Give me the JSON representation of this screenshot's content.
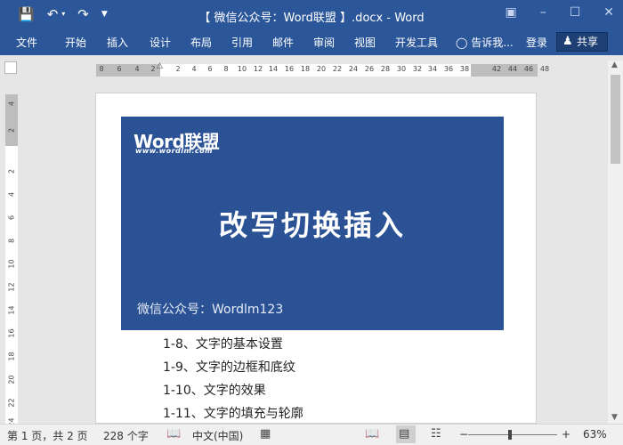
{
  "window": {
    "title": "【 微信公众号：Word联盟 】.docx - Word",
    "icons": [
      "save-icon",
      "undo-icon",
      "undo-dropdown-icon",
      "redo-icon",
      "customize-qat-icon",
      "ribbon-display-icon",
      "minimize-icon",
      "maximize-icon",
      "close-icon"
    ]
  },
  "ribbon": {
    "tabs": [
      "文件",
      "开始",
      "插入",
      "设计",
      "布局",
      "引用",
      "邮件",
      "审阅",
      "视图",
      "开发工具"
    ],
    "tell_me": "告诉我...",
    "login": "登录",
    "share": "共享"
  },
  "ruler": {
    "h_left": [
      "8",
      "6",
      "4",
      "2"
    ],
    "h_right": [
      "2",
      "4",
      "6",
      "8",
      "10",
      "12",
      "14",
      "16",
      "18",
      "20",
      "22",
      "24",
      "26",
      "28",
      "30",
      "32",
      "34",
      "36",
      "38",
      "42",
      "44",
      "46",
      "48"
    ],
    "v_labels": [
      "4",
      "2",
      "2",
      "4",
      "6",
      "8",
      "10",
      "12",
      "14",
      "16",
      "18",
      "20",
      "22",
      "24"
    ]
  },
  "document": {
    "banner": {
      "logo": "Word联盟",
      "logo_url": "www.wordlm.com",
      "title": "改写切换插入",
      "footer": "微信公众号：Wordlm123",
      "color": "#2b5295"
    },
    "lines": [
      "1-8、文字的基本设置",
      "1-9、文字的边框和底纹",
      "1-10、文字的效果",
      "1-11、文字的填充与轮廓"
    ]
  },
  "status": {
    "page": "第 1 页，共 2 页",
    "words": "228 个字",
    "language": "中文(中国)",
    "zoom": "63%",
    "zoom_minus": "−",
    "zoom_plus": "+"
  },
  "colors": {
    "accent": "#2b579a",
    "share_bg": "#1e3f73"
  }
}
